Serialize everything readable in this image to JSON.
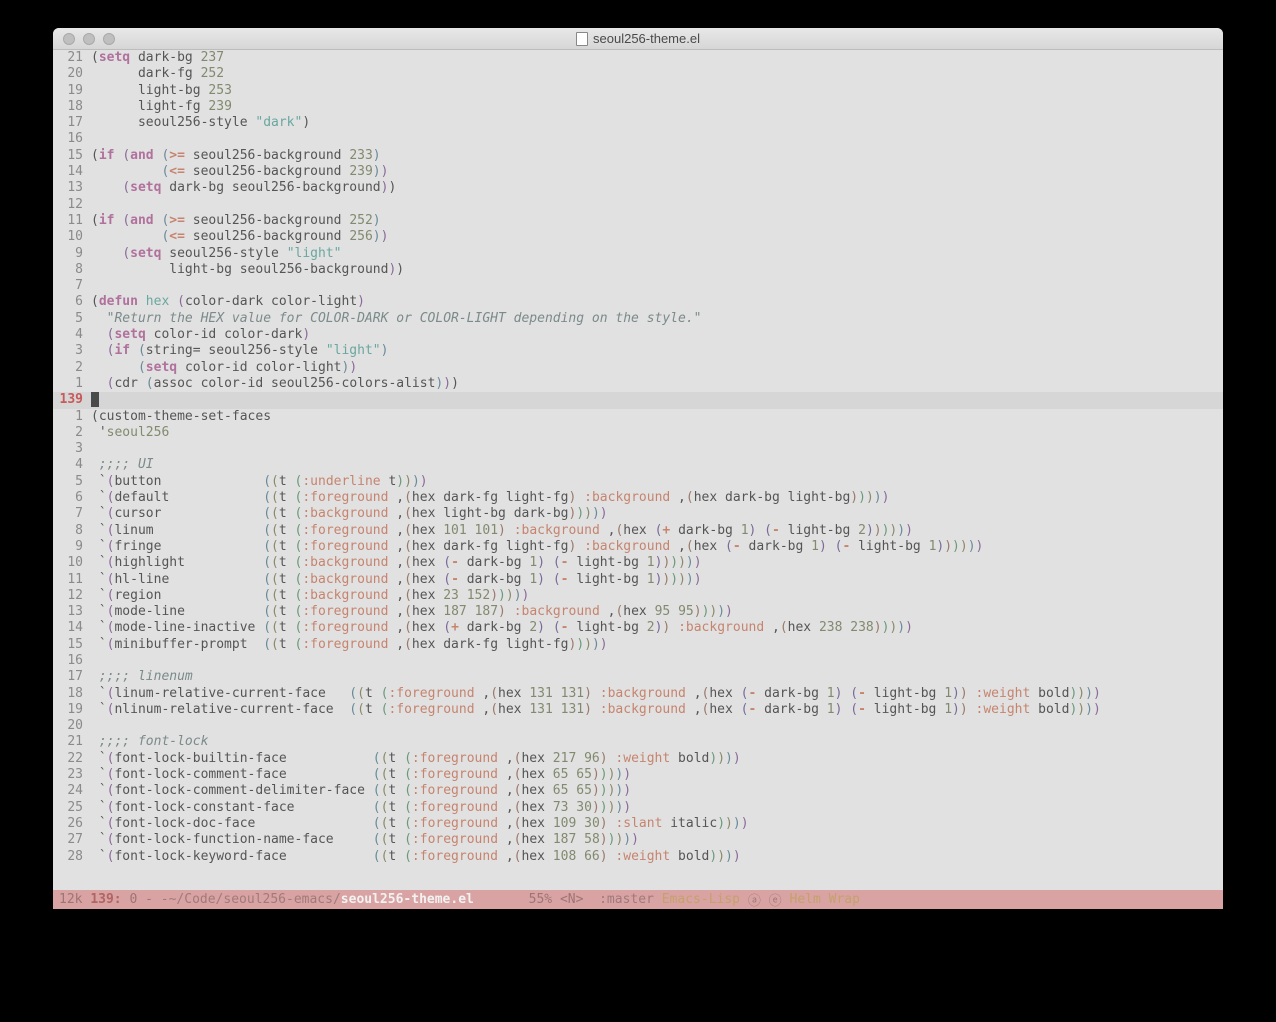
{
  "window": {
    "title": "seoul256-theme.el"
  },
  "gutter": {
    "rel_above": [
      "21",
      "20",
      "19",
      "18",
      "17",
      "16",
      "15",
      "14",
      "13",
      "12",
      "11",
      "10",
      "9",
      "8",
      "7",
      "6",
      "5",
      "4",
      "3",
      "2",
      "1"
    ],
    "current": "139",
    "rel_below": [
      "1",
      "2",
      "3",
      "4",
      "5",
      "6",
      "7",
      "8",
      "9",
      "10",
      "11",
      "12",
      "13",
      "14",
      "15",
      "16",
      "17",
      "18",
      "19",
      "20",
      "21",
      "22",
      "23",
      "24",
      "25",
      "26",
      "27",
      "28"
    ]
  },
  "tokens": {
    "setq": "setq",
    "if": "if",
    "and": "and",
    "defun": "defun",
    "hex": "hex",
    "cdr": "cdr",
    "assoc": "assoc",
    "string_eq": "string=",
    "custom_theme_set_faces": "custom-theme-set-faces",
    "seoul256": "seoul256",
    "ge": ">=",
    "le": "<=",
    "minus": "-",
    "plus": "+",
    "t": "t",
    "dark_bg": "dark-bg",
    "dark_fg": "dark-fg",
    "light_bg": "light-bg",
    "light_fg": "light-fg",
    "seoul256_style": "seoul256-style",
    "seoul256_background": "seoul256-background",
    "seoul256_colors_alist": "seoul256-colors-alist",
    "color_dark": "color-dark",
    "color_light": "color-light",
    "color_id": "color-id",
    "str_dark": "\"dark\"",
    "str_light": "\"light\"",
    "doc_hex": "\"Return the HEX value for COLOR-DARK or COLOR-LIGHT depending on the style.\"",
    "c_ui": ";;;; UI",
    "c_linenum": ";;;; linenum",
    "c_fontlock": ";;;; font-lock",
    "face_button": "button",
    "face_default": "default",
    "face_cursor": "cursor",
    "face_linum": "linum",
    "face_fringe": "fringe",
    "face_highlight": "highlight",
    "face_hlline": "hl-line",
    "face_region": "region",
    "face_modeline": "mode-line",
    "face_modeline_inactive": "mode-line-inactive",
    "face_minibuffer": "minibuffer-prompt",
    "face_linum_rel": "linum-relative-current-face",
    "face_nlinum_rel": "nlinum-relative-current-face",
    "face_flb": "font-lock-builtin-face",
    "face_flc": "font-lock-comment-face",
    "face_flcd": "font-lock-comment-delimiter-face",
    "face_flco": "font-lock-constant-face",
    "face_fld": "font-lock-doc-face",
    "face_flfn": "font-lock-function-name-face",
    "face_flkw": "font-lock-keyword-face",
    "kw_underline": ":underline",
    "kw_foreground": ":foreground",
    "kw_background": ":background",
    "kw_weight": ":weight",
    "kw_slant": ":slant",
    "bold": "bold",
    "italic": "italic",
    "n237": "237",
    "n252": "252",
    "n253": "253",
    "n239": "239",
    "n233": "233",
    "n256": "256",
    "n101": "101",
    "n1": "1",
    "n2": "2",
    "n23": "23",
    "n152": "152",
    "n187": "187",
    "n95": "95",
    "n238": "238",
    "n131": "131",
    "n217": "217",
    "n96": "96",
    "n65": "65",
    "n73": "73",
    "n30": "30",
    "n109": "109",
    "n58": "58",
    "n108": "108",
    "n66": "66"
  },
  "modeline": {
    "size": "12k",
    "line": "139:",
    "col": "0",
    "sep1": " - ",
    "tilde": "-~/",
    "path": "Code/seoul256-emacs/",
    "file": "seoul256-theme.el",
    "percent": "55%",
    "narrow": "<N>",
    "vc": ":master",
    "major": "Emacs-Lisp",
    "sym": "ⓐ ⓔ",
    "minor": "Helm Wrap"
  }
}
